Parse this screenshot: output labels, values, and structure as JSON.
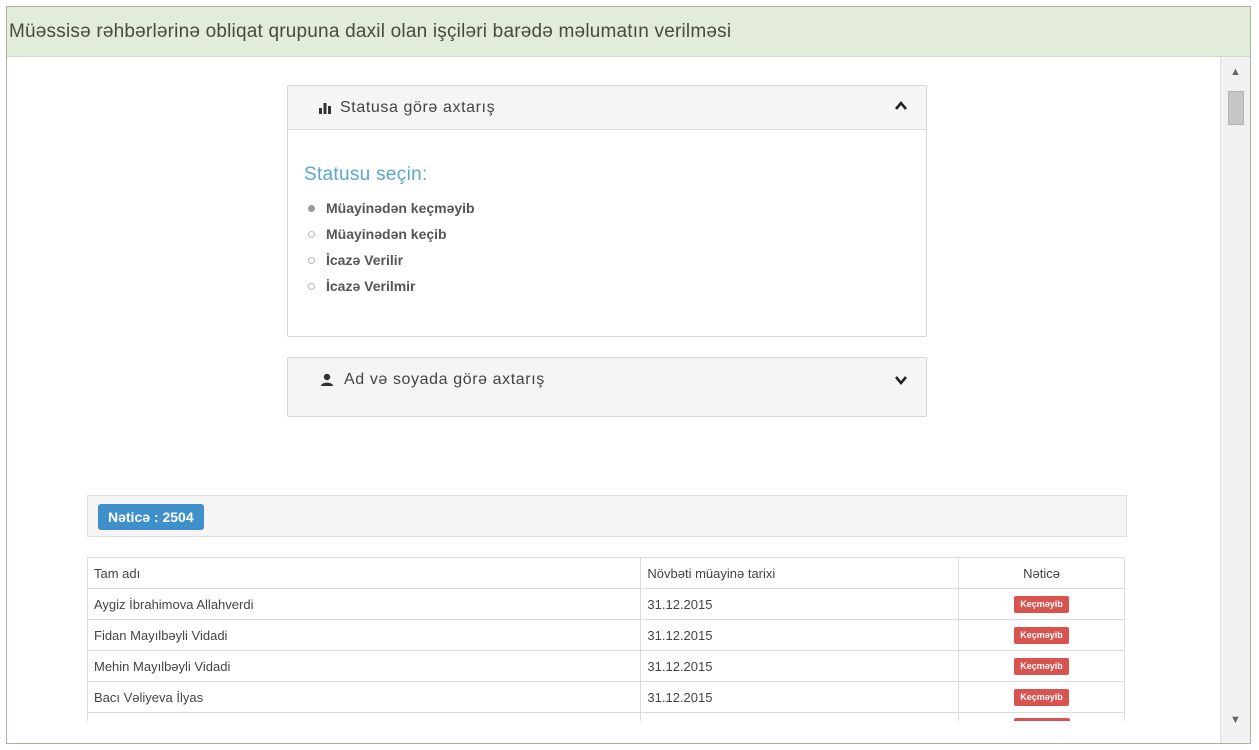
{
  "page_title": "Müəssisə rəhbərlərinə obliqat qrupuna daxil olan işçiləri barədə məlumatın verilməsi",
  "panels": {
    "status": {
      "title": "Statusa görə axtarış",
      "icon": "bar-chart-icon",
      "expanded": true,
      "heading": "Statusu seçin:",
      "options": [
        {
          "label": "Müayinədən keçməyib",
          "selected": true
        },
        {
          "label": "Müayinədən keçib",
          "selected": false
        },
        {
          "label": "İcazə Verilir",
          "selected": false
        },
        {
          "label": "İcazə Verilmir",
          "selected": false
        }
      ]
    },
    "name_search": {
      "title": "Ad və soyada görə axtarış",
      "icon": "user-icon",
      "expanded": false
    }
  },
  "result": {
    "label": "Nəticə : 2504"
  },
  "table": {
    "headers": [
      "Tam adı",
      "Növbəti müayinə tarixi",
      "Nəticə"
    ],
    "rows": [
      {
        "name": "Aygiz İbrahimova Allahverdi",
        "date": "31.12.2015",
        "status": "Keçməyib"
      },
      {
        "name": "Fidan Mayılbəyli Vidadi",
        "date": "31.12.2015",
        "status": "Keçməyib"
      },
      {
        "name": "Mehin Mayılbəyli Vidadi",
        "date": "31.12.2015",
        "status": "Keçməyib"
      },
      {
        "name": "Bacı Vəliyeva İlyas",
        "date": "31.12.2015",
        "status": "Keçməyib"
      },
      {
        "name": "",
        "date": "",
        "status": ""
      }
    ]
  },
  "colors": {
    "titlebar_bg": "#e3ecd8",
    "heading_blue": "#5aa6d1",
    "badge_blue": "#3f8fcb",
    "badge_red": "#d9534f"
  }
}
